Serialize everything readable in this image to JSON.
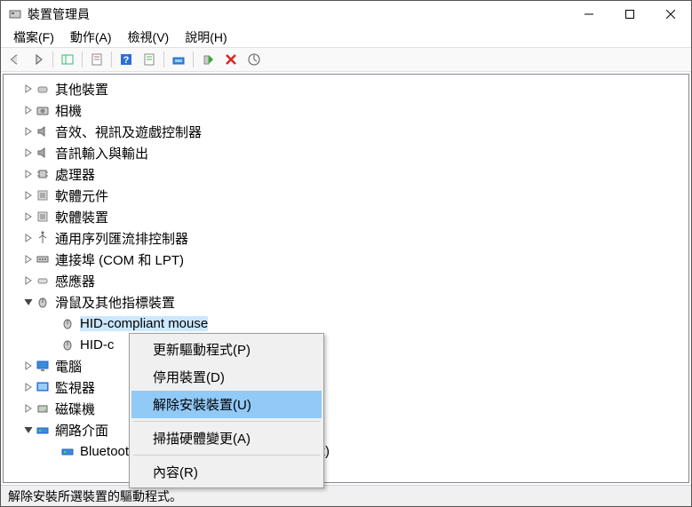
{
  "window": {
    "title": "裝置管理員"
  },
  "menu": {
    "file": "檔案(F)",
    "action": "動作(A)",
    "view": "檢視(V)",
    "help": "說明(H)"
  },
  "categories": [
    {
      "name": "其他裝置",
      "icon": "other",
      "expanded": false
    },
    {
      "name": "相機",
      "icon": "camera",
      "expanded": false
    },
    {
      "name": "音效、視訊及遊戲控制器",
      "icon": "audio",
      "expanded": false
    },
    {
      "name": "音訊輸入與輸出",
      "icon": "audio",
      "expanded": false
    },
    {
      "name": "處理器",
      "icon": "cpu",
      "expanded": false
    },
    {
      "name": "軟體元件",
      "icon": "sw",
      "expanded": false
    },
    {
      "name": "軟體裝置",
      "icon": "sw",
      "expanded": false
    },
    {
      "name": "通用序列匯流排控制器",
      "icon": "usb",
      "expanded": false
    },
    {
      "name": "連接埠 (COM 和 LPT)",
      "icon": "port",
      "expanded": false
    },
    {
      "name": "感應器",
      "icon": "sensor",
      "expanded": false
    },
    {
      "name": "滑鼠及其他指標裝置",
      "icon": "mouse",
      "expanded": true,
      "children": [
        {
          "name": "HID-compliant mouse",
          "selected": true
        },
        {
          "name": "HID-c"
        }
      ]
    },
    {
      "name": "電腦",
      "icon": "computer",
      "expanded": false
    },
    {
      "name": "監視器",
      "icon": "monitor",
      "expanded": false
    },
    {
      "name": "磁碟機",
      "icon": "disk",
      "expanded": false
    },
    {
      "name": "網路介面",
      "icon": "network",
      "expanded": true,
      "partial_expander": "v",
      "children": [
        {
          "name": "Bluetooth Device (Personal Area Network)",
          "icon": "net-item"
        }
      ]
    }
  ],
  "context": {
    "update": "更新驅動程式(P)",
    "disable": "停用裝置(D)",
    "uninstall": "解除安裝裝置(U)",
    "scan": "掃描硬體變更(A)",
    "properties": "內容(R)"
  },
  "status": "解除安裝所選裝置的驅動程式。"
}
